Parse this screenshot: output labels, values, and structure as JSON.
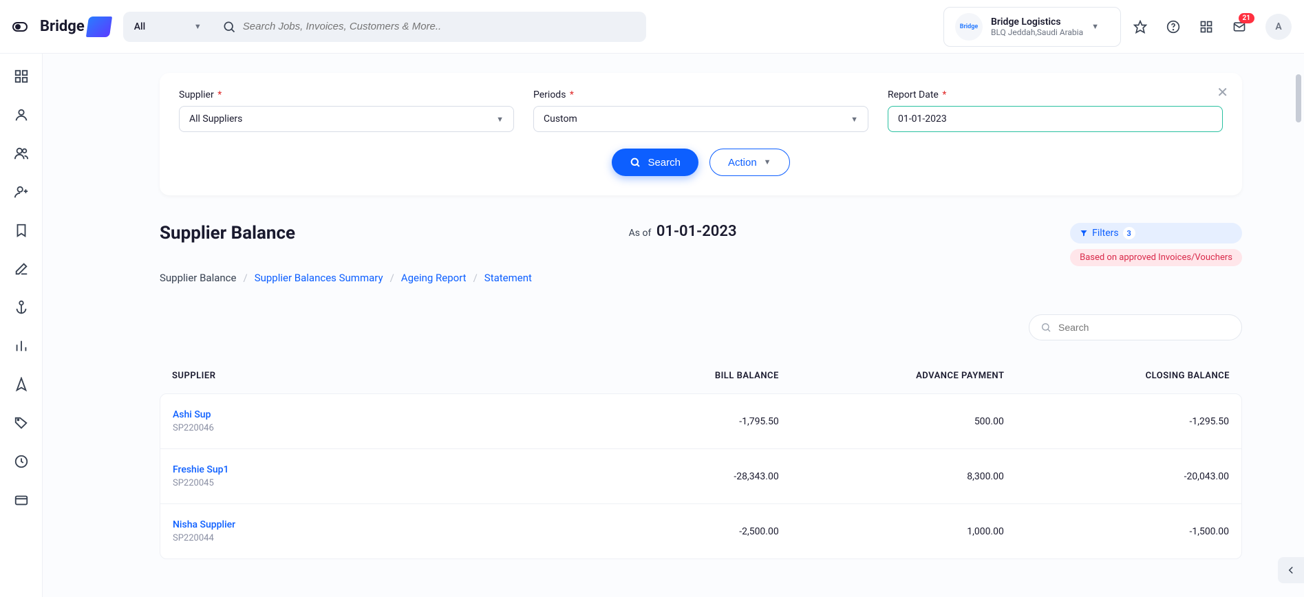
{
  "header": {
    "brand": "Bridge",
    "search_category": "All",
    "search_placeholder": "Search Jobs, Invoices, Customers & More..",
    "org_name": "Bridge Logistics",
    "org_loc": "BLQ Jeddah,Saudi Arabia",
    "notification_count": "21",
    "avatar_initial": "A"
  },
  "filters": {
    "supplier_label": "Supplier",
    "supplier_value": "All Suppliers",
    "periods_label": "Periods",
    "periods_value": "Custom",
    "report_date_label": "Report Date",
    "report_date_value": "01-01-2023",
    "search_btn": "Search",
    "action_btn": "Action"
  },
  "page": {
    "title": "Supplier Balance",
    "asof_prefix": "As of",
    "asof_date": "01-01-2023",
    "filters_label": "Filters",
    "filters_count": "3",
    "based_on": "Based on approved Invoices/Vouchers"
  },
  "crumbs": {
    "c1": "Supplier Balance",
    "c2": "Supplier Balances Summary",
    "c3": "Ageing Report",
    "c4": "Statement"
  },
  "table_search_placeholder": "Search",
  "columns": {
    "c1": "SUPPLIER",
    "c2": "BILL BALANCE",
    "c3": "ADVANCE PAYMENT",
    "c4": "CLOSING BALANCE"
  },
  "rows": [
    {
      "name": "Ashi Sup",
      "id": "SP220046",
      "bill": "-1,795.50",
      "adv": "500.00",
      "close": "-1,295.50"
    },
    {
      "name": "Freshie Sup1",
      "id": "SP220045",
      "bill": "-28,343.00",
      "adv": "8,300.00",
      "close": "-20,043.00"
    },
    {
      "name": "Nisha Supplier",
      "id": "SP220044",
      "bill": "-2,500.00",
      "adv": "1,000.00",
      "close": "-1,500.00"
    }
  ]
}
